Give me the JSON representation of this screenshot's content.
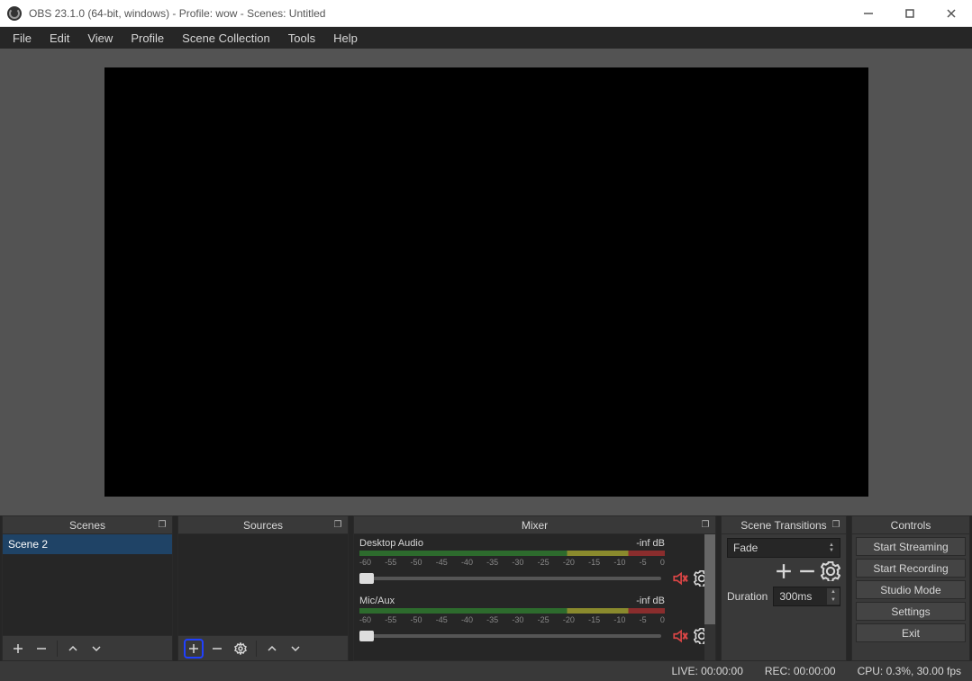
{
  "titlebar": {
    "title": "OBS 23.1.0 (64-bit, windows) - Profile: wow - Scenes: Untitled"
  },
  "menubar": {
    "items": [
      "File",
      "Edit",
      "View",
      "Profile",
      "Scene Collection",
      "Tools",
      "Help"
    ]
  },
  "panels": {
    "scenes": {
      "title": "Scenes",
      "items": [
        "Scene 2"
      ]
    },
    "sources": {
      "title": "Sources"
    },
    "mixer": {
      "title": "Mixer",
      "channels": [
        {
          "name": "Desktop Audio",
          "level": "-inf dB"
        },
        {
          "name": "Mic/Aux",
          "level": "-inf dB"
        }
      ],
      "ticks": [
        "-60",
        "-55",
        "-50",
        "-45",
        "-40",
        "-35",
        "-30",
        "-25",
        "-20",
        "-15",
        "-10",
        "-5",
        "0"
      ]
    },
    "transitions": {
      "title": "Scene Transitions",
      "selected": "Fade",
      "duration_label": "Duration",
      "duration_value": "300ms"
    },
    "controls": {
      "title": "Controls",
      "buttons": [
        "Start Streaming",
        "Start Recording",
        "Studio Mode",
        "Settings",
        "Exit"
      ]
    }
  },
  "statusbar": {
    "live": "LIVE: 00:00:00",
    "rec": "REC: 00:00:00",
    "cpu": "CPU: 0.3%, 30.00 fps"
  }
}
